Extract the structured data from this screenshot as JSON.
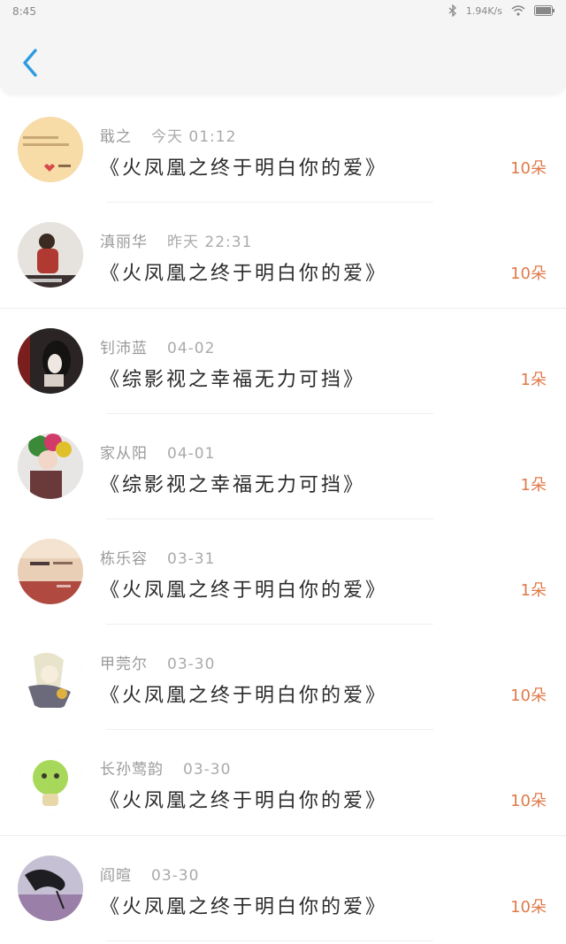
{
  "status": {
    "time": "8:45",
    "speed": "1.94K/s",
    "battery": "100"
  },
  "nav": {
    "back_icon": "chevron-left-icon",
    "accent": "#2f9be0"
  },
  "colors": {
    "count": "#e07a4a",
    "meta": "#9a9a9a"
  },
  "items": [
    {
      "name": "戢之",
      "time": "今天 01:12",
      "title": "《火凤凰之终于明白你的爱》",
      "count": "10朵"
    },
    {
      "name": "滇丽华",
      "time": "昨天 22:31",
      "title": "《火凤凰之终于明白你的爱》",
      "count": "10朵"
    },
    {
      "name": "钊沛蓝",
      "time": "04-02",
      "title": "《综影视之幸福无力可挡》",
      "count": "1朵"
    },
    {
      "name": "家从阳",
      "time": "04-01",
      "title": "《综影视之幸福无力可挡》",
      "count": "1朵"
    },
    {
      "name": "栋乐容",
      "time": "03-31",
      "title": "《火凤凰之终于明白你的爱》",
      "count": "1朵"
    },
    {
      "name": "甲莞尔",
      "time": "03-30",
      "title": "《火凤凰之终于明白你的爱》",
      "count": "10朵"
    },
    {
      "name": "长孙莺韵",
      "time": "03-30",
      "title": "《火凤凰之终于明白你的爱》",
      "count": "10朵"
    },
    {
      "name": "阎暄",
      "time": "03-30",
      "title": "《火凤凰之终于明白你的爱》",
      "count": "10朵"
    }
  ]
}
